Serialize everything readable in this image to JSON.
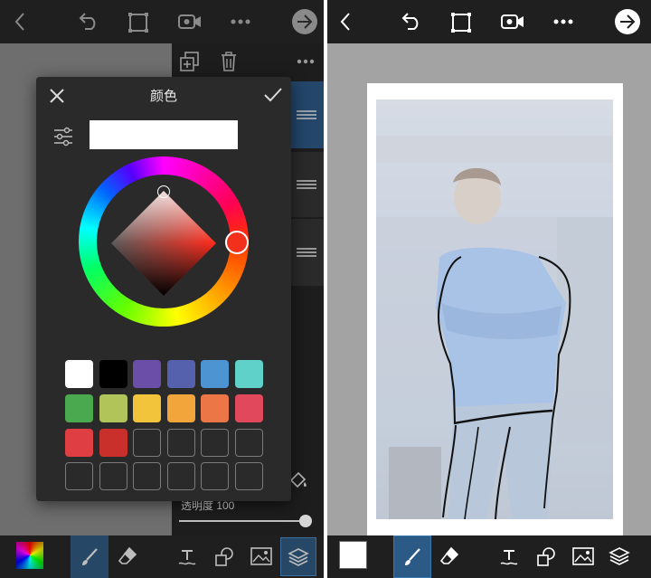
{
  "dialog": {
    "title": "颜色",
    "hex_value": ""
  },
  "layers": {
    "opacity_label": "透明度 100",
    "opacity_percent": 100
  },
  "colors": {
    "accent": "#2f86c6",
    "selected_color": "#c9302c",
    "swatches_row1": [
      "#ffffff",
      "#000000",
      "#6a4ea8",
      "#5561ad",
      "#4d94d2",
      "#5fd1c8"
    ],
    "swatches_row2": [
      "#4aa84e",
      "#b1c45a",
      "#f2c43c",
      "#f2a53a",
      "#ec7646",
      "#e2485c"
    ],
    "swatches_row3": [
      "#df3f43",
      "#c9302c"
    ]
  },
  "icons": {
    "back": "chevron-left-icon",
    "undo": "undo-icon",
    "crop": "crop-icon",
    "video": "video-camera-icon",
    "more": "more-dots-icon",
    "next": "arrow-right-circle-icon",
    "brush": "brush-icon",
    "eraser": "eraser-icon",
    "text": "text-icon",
    "sticker": "sticker-icon",
    "image": "image-icon",
    "layers": "layers-icon"
  }
}
